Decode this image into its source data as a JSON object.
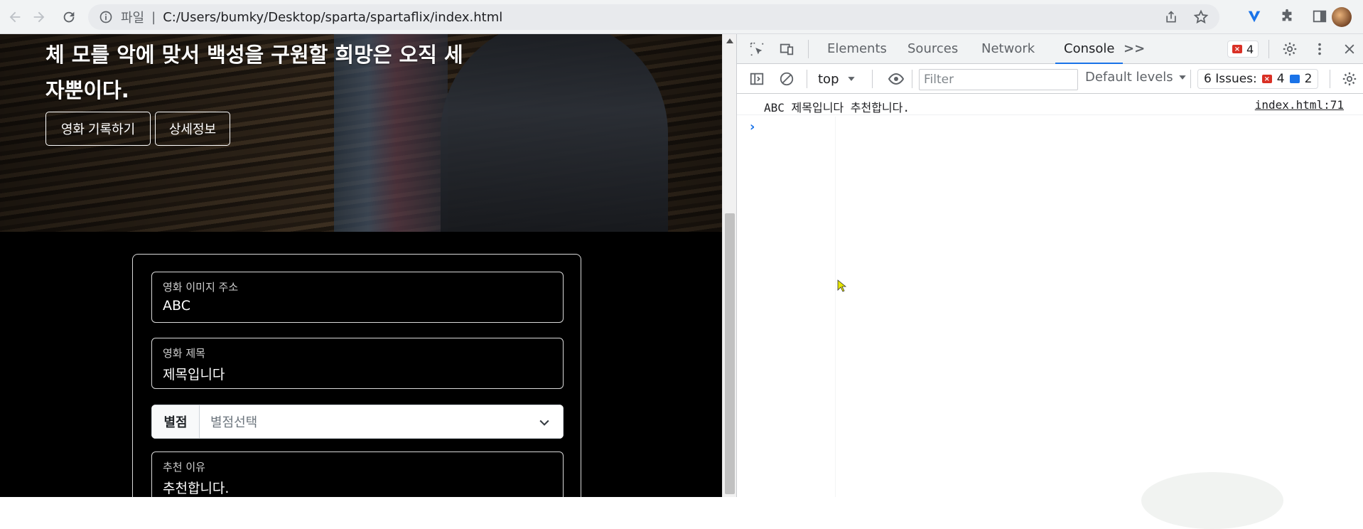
{
  "browser": {
    "address": {
      "scheme": "파일",
      "separator": "|",
      "url": "C:/Users/bumky/Desktop/sparta/spartaflix/index.html"
    }
  },
  "page": {
    "hero": {
      "description": "체 모를 악에 맞서 백성을 구원할 희망은 오직 세자뿐이다.",
      "record_button": "영화 기록하기",
      "detail_button": "상세정보"
    },
    "form": {
      "image_label": "영화 이미지 주소",
      "image_value": "ABC",
      "title_label": "영화 제목",
      "title_value": "제목입니다",
      "rating_label": "별점",
      "rating_placeholder": "별점선택",
      "reason_label": "추천 이유",
      "reason_value": "추천합니다."
    }
  },
  "devtools": {
    "tabs": [
      "Elements",
      "Sources",
      "Network",
      "Console"
    ],
    "active_tab": "Console",
    "more_tabs": ">>",
    "error_count": "4",
    "context": "top",
    "filter_placeholder": "Filter",
    "levels": "Default levels",
    "issues_label": "6 Issues:",
    "issues_errors": "4",
    "issues_info": "2",
    "log": {
      "message": "ABC 제목입니다 추천합니다.",
      "source": "index.html:71"
    },
    "prompt": "›",
    "colors": {
      "active_tab": "#1a73e8",
      "error": "#d93025"
    }
  }
}
